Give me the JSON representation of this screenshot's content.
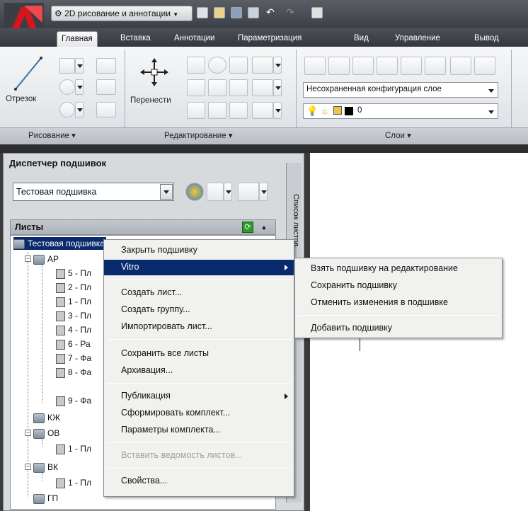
{
  "quick_access": {
    "workspace": "2D рисование и аннотации"
  },
  "tabs": [
    "Главная",
    "Вставка",
    "Аннотации",
    "Параметризация",
    "Вид",
    "Управление",
    "Вывод"
  ],
  "ribbon": {
    "draw": {
      "line_label": "Отрезок",
      "panel": "Рисование ▾"
    },
    "modify": {
      "move_label": "Перенести",
      "panel": "Редактирование ▾"
    },
    "layers": {
      "layer_state": "Несохраненная конфигурация слое",
      "current_layer": "0",
      "panel": "Слои ▾"
    }
  },
  "sheet_manager": {
    "title": "Диспетчер подшивок",
    "combo_value": "Тестовая подшивка",
    "vertical_tab": "Список листов",
    "sheets_header": "Листы",
    "root": "Тестовая подшивка",
    "groups": [
      {
        "label": "АР",
        "sheets": [
          "5 - Пл",
          "2 - Пл",
          "1 - Пл",
          "3 - Пл",
          "4 - Пл",
          "6 - Ра",
          "7 - Фа",
          "8 - Фа",
          "9 - Фа"
        ]
      },
      {
        "label": "КЖ",
        "sheets": []
      },
      {
        "label": "ОВ",
        "sheets": [
          "1 - Пл"
        ]
      },
      {
        "label": "ВК",
        "sheets": [
          "1 - Пл"
        ]
      },
      {
        "label": "ГП",
        "sheets": []
      }
    ]
  },
  "context_menu": {
    "items": [
      "Закрыть подшивку",
      "Vitro",
      "Создать лист...",
      "Создать группу...",
      "Импортировать лист...",
      "Сохранить все листы",
      "Архивация...",
      "Публикация",
      "Сформировать комплект...",
      "Параметры комплекта...",
      "Вставить ведомость листов...",
      "Свойства..."
    ]
  },
  "submenu": {
    "items": [
      "Взять подшивку на редактирование",
      "Сохранить подшивку",
      "Отменить изменения в подшивке",
      "Добавить подшивку"
    ]
  },
  "colors": {
    "app_red": "#c8161d",
    "selection": "#0a2a6e",
    "refresh_green": "#2f9a2f"
  }
}
